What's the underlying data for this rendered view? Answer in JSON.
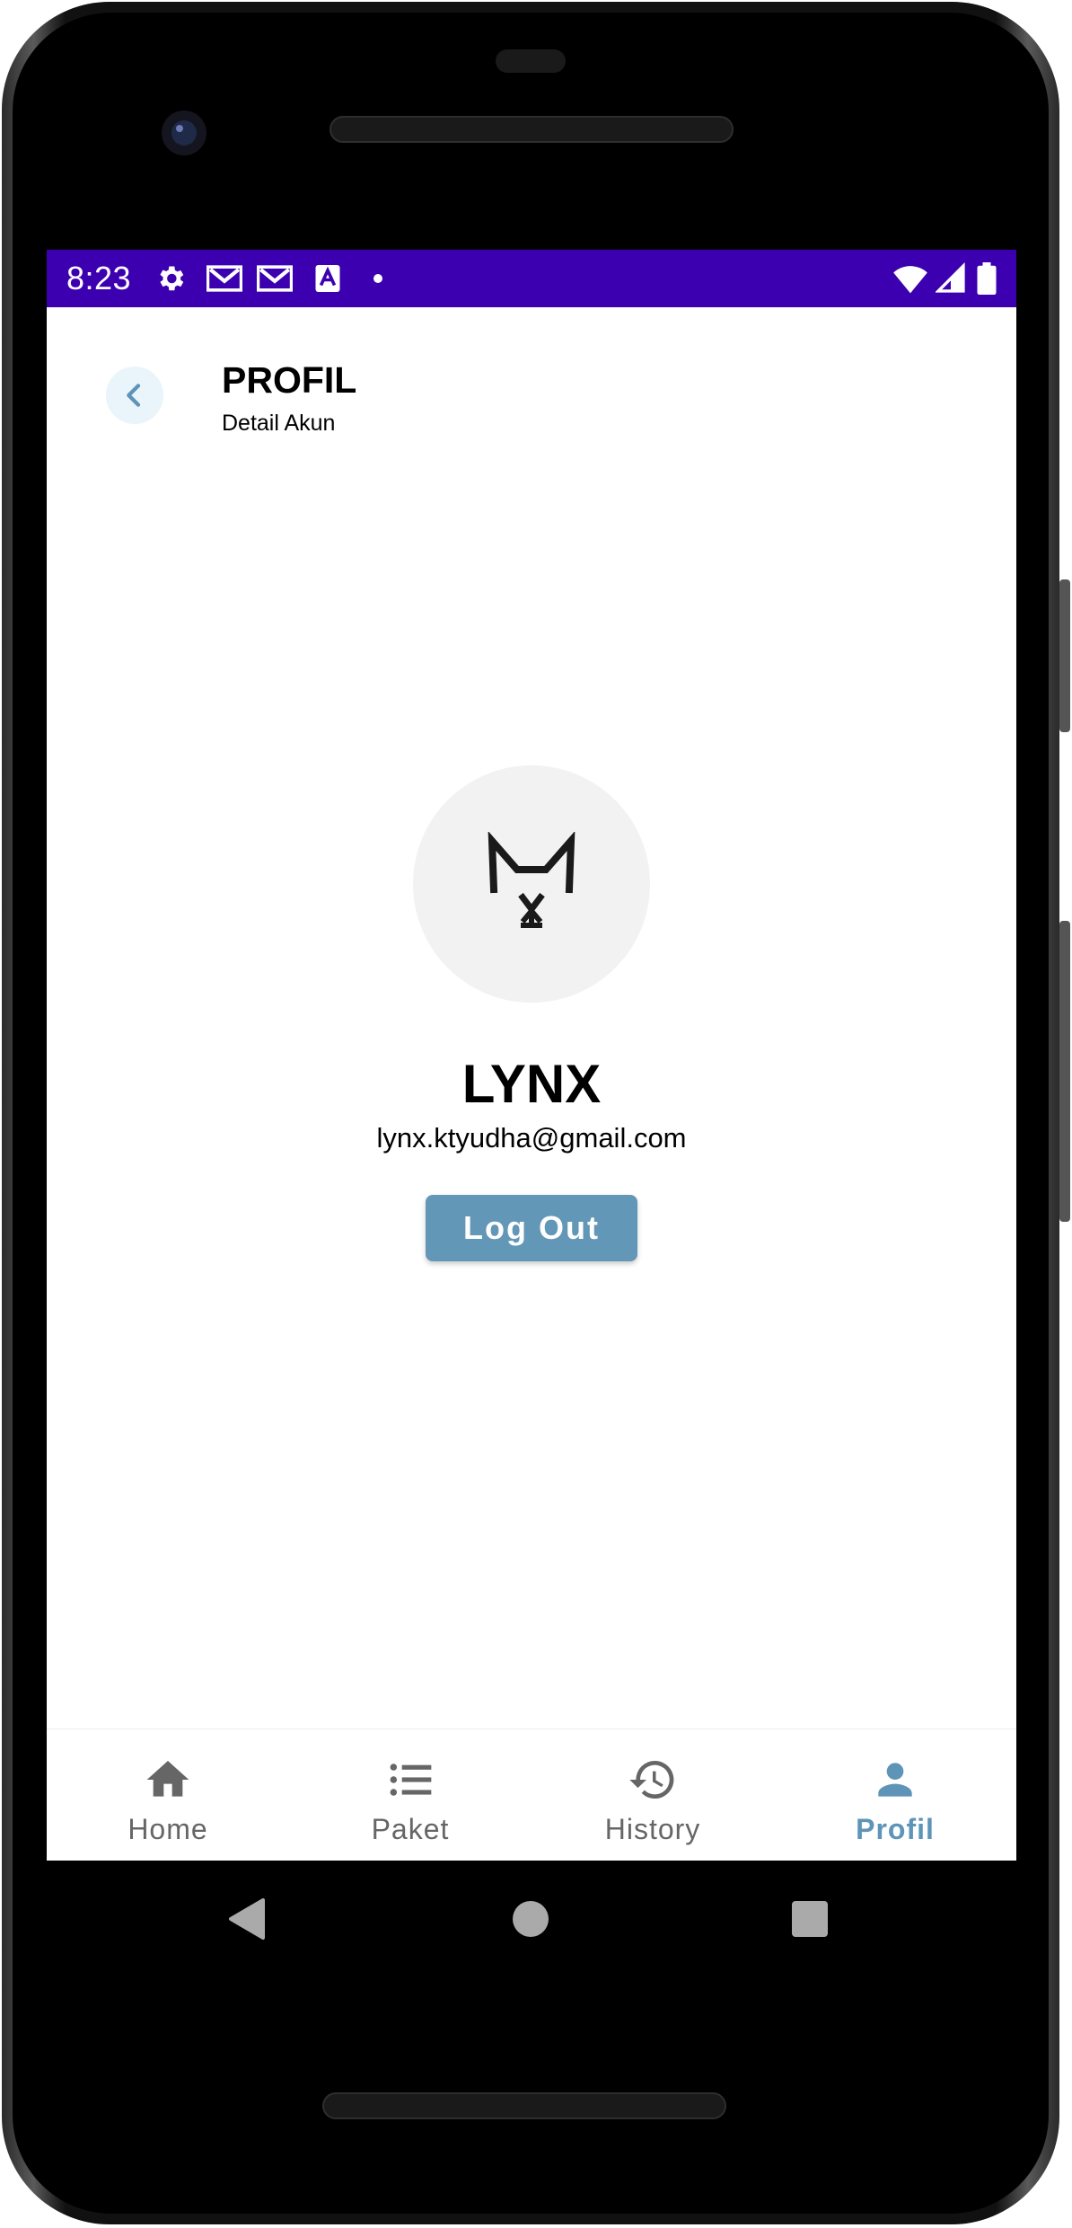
{
  "status_bar": {
    "time": "8:23",
    "left_icons": [
      "gear-icon",
      "gmail-icon",
      "gmail-icon",
      "text-a-icon",
      "dot-icon"
    ],
    "right_icons": [
      "wifi-icon",
      "signal-icon",
      "battery-icon"
    ],
    "background": "#3d00b0"
  },
  "header": {
    "title": "PROFIL",
    "subtitle": "Detail Akun",
    "back_icon": "chevron-left-icon"
  },
  "profile": {
    "avatar_icon": "lynx-logo-icon",
    "name": "LYNX",
    "email": "lynx.ktyudha@gmail.com",
    "logout_label": "Log Out"
  },
  "bottom_nav": {
    "items": [
      {
        "label": "Home",
        "icon": "home-icon",
        "active": false
      },
      {
        "label": "Paket",
        "icon": "list-icon",
        "active": false
      },
      {
        "label": "History",
        "icon": "history-icon",
        "active": false
      },
      {
        "label": "Profil",
        "icon": "person-icon",
        "active": true
      }
    ]
  },
  "colors": {
    "accent": "#6397b8",
    "active_nav": "#5d94b8",
    "inactive_nav": "#666666",
    "status_bar": "#3d00b0"
  },
  "system_nav": {
    "icons": [
      "back-triangle-icon",
      "home-circle-icon",
      "recents-square-icon"
    ]
  }
}
